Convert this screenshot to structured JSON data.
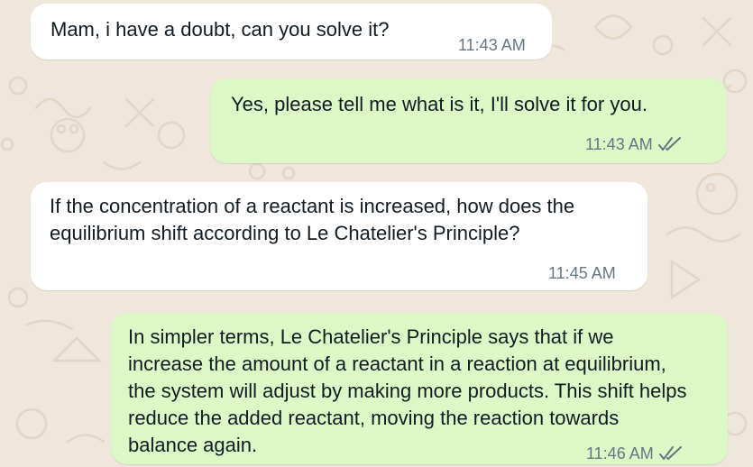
{
  "chat": {
    "messages": [
      {
        "direction": "incoming",
        "text": "Mam, i have a doubt, can you solve it?",
        "time": "11:43 AM"
      },
      {
        "direction": "outgoing",
        "text": "Yes, please tell me what is it, I'll solve it for you.",
        "time": "11:43 AM",
        "status_icon": "double-check-icon"
      },
      {
        "direction": "incoming",
        "text": "If the concentration of a reactant is increased, how does the equilibrium shift according to Le Chatelier's Principle?",
        "time": "11:45 AM"
      },
      {
        "direction": "outgoing",
        "text": "In simpler terms, Le Chatelier's Principle says that if we increase the amount of a reactant in a reaction at equilibrium, the system will adjust by making more products. This shift helps reduce the added reactant, moving the reaction towards balance again.",
        "time": "11:46 AM",
        "status_icon": "double-check-icon"
      }
    ]
  },
  "colors": {
    "background": "#efe7dc",
    "incoming_bubble": "#ffffff",
    "outgoing_bubble": "#dcf8c6",
    "text": "#111b21",
    "meta": "#667781",
    "doodle": "#e3d6c6"
  }
}
